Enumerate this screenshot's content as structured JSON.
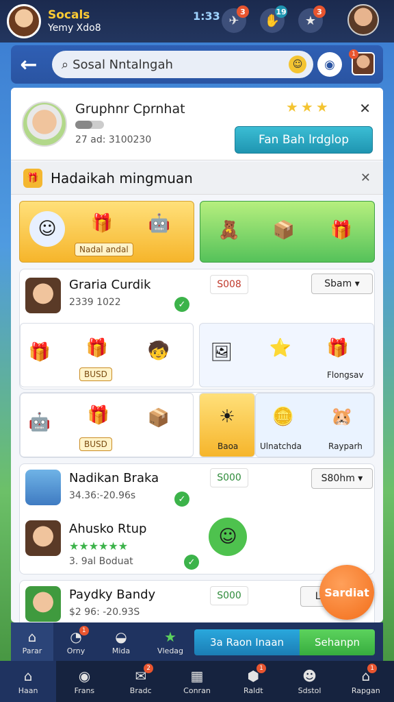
{
  "topbar": {
    "brand_name": "Socals",
    "subtitle": "Yemy Xdo8",
    "count": "1:33",
    "badges": [
      "3",
      "19",
      "3"
    ]
  },
  "search": {
    "placeholder": "Sosal Nntalngah"
  },
  "profile": {
    "name": "Gruphnr Cprnhat",
    "stats": "27 ad: 3100230",
    "button": "Fan Bah lrdglop"
  },
  "section": {
    "title": "Hadaikah mingmuan"
  },
  "banner": {
    "label": "Nadal andal"
  },
  "cards": [
    {
      "title": "Graria Curdik",
      "sub": "2339 1022",
      "price": "S008",
      "select": "Sbam"
    },
    {
      "title": "Nadikan Braka",
      "sub": "34.36:-20.96s",
      "price": "S000",
      "select": "S80hm"
    },
    {
      "title": "Ahusko Rtup",
      "sub": "3.  9al  Boduat",
      "stars": "★★★★★★"
    },
    {
      "title": "Paydky Bandy",
      "sub": "$2 96: -20.93S",
      "price": "S000",
      "select": "La"
    }
  ],
  "row1": {
    "gift2_label": "BUSD",
    "caption": "Flongsav"
  },
  "row2": {
    "gift2_label": "BUSD",
    "c1": "Baoa",
    "c2": "Ulnatchda",
    "c3": "Rayparh"
  },
  "fab": {
    "label": "Sardiat"
  },
  "navbar": [
    {
      "label": "Parar",
      "icon": "⌂"
    },
    {
      "label": "Orny",
      "icon": "◔",
      "badge": "1"
    },
    {
      "label": "Mida",
      "icon": "◒"
    },
    {
      "label": "Vledag",
      "icon": "★"
    }
  ],
  "actions": {
    "blue": "3a  Raon Inaan",
    "green": "Sehanpn"
  },
  "bottombar": [
    {
      "label": "Haan",
      "icon": "⌂"
    },
    {
      "label": "Frans",
      "icon": "◉"
    },
    {
      "label": "Bradc",
      "icon": "✉",
      "badge": "2"
    },
    {
      "label": "Conran",
      "icon": "▦"
    },
    {
      "label": "Raldt",
      "icon": "⬢",
      "badge": "1"
    },
    {
      "label": "Sdstol",
      "icon": "☻"
    },
    {
      "label": "Rapgan",
      "icon": "⌂",
      "badge": "1"
    }
  ],
  "colors": {
    "accent": "#2a54a2",
    "cta": "#1f95b1",
    "success": "#3cb34a",
    "badge": "#e8552f",
    "fab": "#f26e1a"
  }
}
